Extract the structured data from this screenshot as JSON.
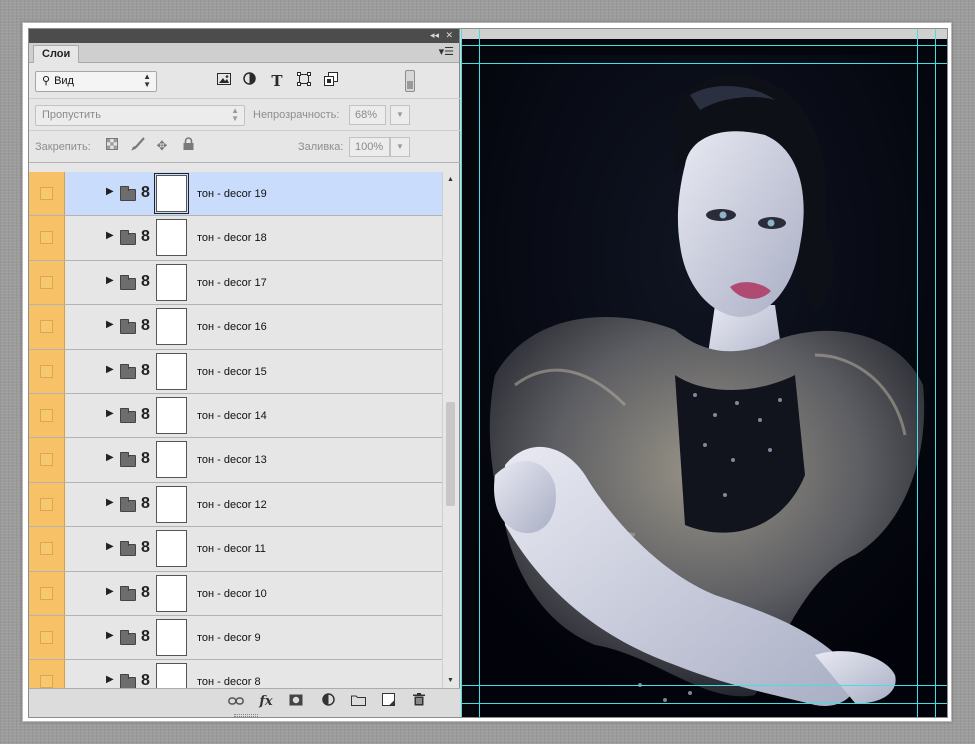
{
  "panel": {
    "tab_label": "Слои",
    "filter": {
      "value": "Вид",
      "icon": "search-icon"
    },
    "filter_icons": [
      "image-filter-icon",
      "adjustment-filter-icon",
      "text-filter-icon",
      "shape-filter-icon",
      "smart-object-filter-icon"
    ],
    "blend_mode": "Пропустить",
    "opacity_label": "Непрозрачность:",
    "opacity_value": "68%",
    "lock_label": "Закрепить:",
    "lock_icons": [
      "lock-transparent-icon",
      "lock-paint-icon",
      "lock-move-icon",
      "lock-all-icon"
    ],
    "fill_label": "Заливка:",
    "fill_value": "100%",
    "text_filter_glyph": "T"
  },
  "layers": [
    {
      "name": "тон - decor 19",
      "selected": true
    },
    {
      "name": "тон - decor 18",
      "selected": false
    },
    {
      "name": "тон - decor 17",
      "selected": false
    },
    {
      "name": "тон - decor 16",
      "selected": false
    },
    {
      "name": "тон - decor 15",
      "selected": false
    },
    {
      "name": "тон - decor 14",
      "selected": false
    },
    {
      "name": "тон - decor 13",
      "selected": false
    },
    {
      "name": "тон - decor 12",
      "selected": false
    },
    {
      "name": "тон - decor 11",
      "selected": false
    },
    {
      "name": "тон - decor 10",
      "selected": false
    },
    {
      "name": "тон - decor 9",
      "selected": false
    },
    {
      "name": "тон - decor 8",
      "selected": false
    }
  ],
  "footer_icons": [
    "link-layers-icon",
    "fx-icon",
    "add-mask-icon",
    "adjustment-layer-icon",
    "new-group-icon",
    "new-layer-icon",
    "trash-icon"
  ],
  "footer_fx_label": "fx",
  "colors": {
    "visibility_column": "#f7c267",
    "selected_row": "#c9dcfb",
    "guide": "#3fe0e6",
    "panel_bg": "#e6e6e6"
  }
}
